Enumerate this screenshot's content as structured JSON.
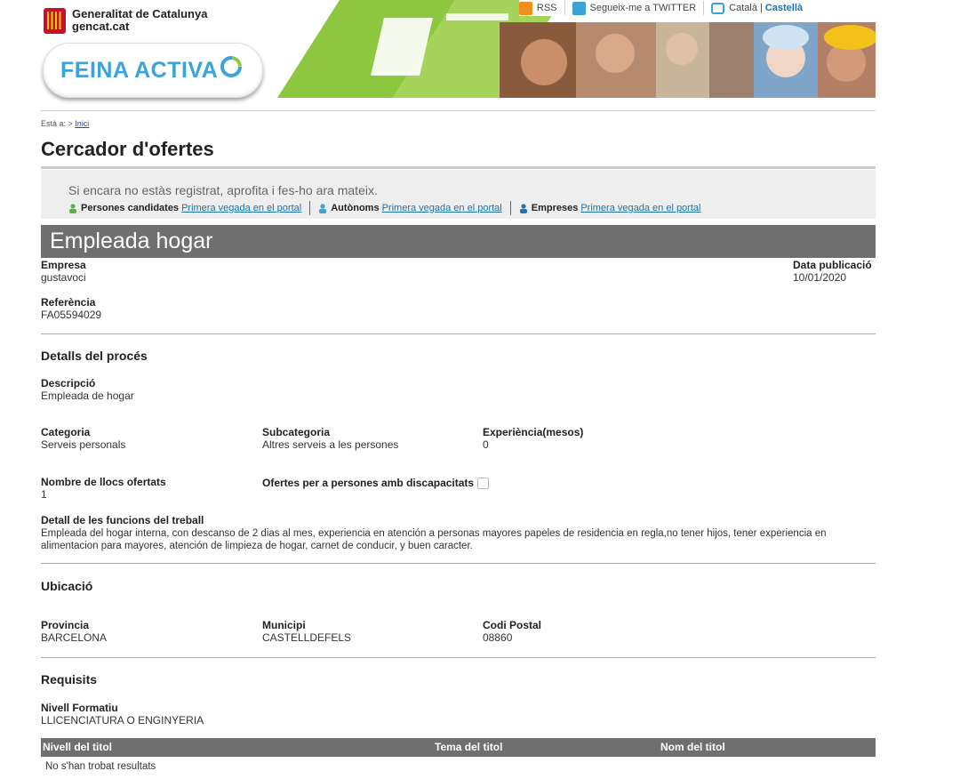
{
  "header": {
    "gencat_line1": "Generalitat de Catalunya",
    "gencat_line2": "gencat.cat",
    "logo_text": "FEINA ACTIVA",
    "toplinks": {
      "rss": "RSS",
      "twitter": "Segueix-me a TWITTER",
      "lang_ca": "Català",
      "lang_sep": "|",
      "lang_es": "Castellà"
    }
  },
  "breadcrumb": {
    "prefix": "Està a: >",
    "home": "Inici"
  },
  "page_title": "Cercador d'ofertes",
  "notice": {
    "main": "Si encara no estàs registrat, aprofita i fes-ho ara mateix.",
    "links": [
      {
        "label": "Persones candidates",
        "link": "Primera vegada en el portal"
      },
      {
        "label": "Autònoms",
        "link": "Primera vegada en el portal"
      },
      {
        "label": "Empreses",
        "link": "Primera vegada en el portal"
      }
    ]
  },
  "offer": {
    "title": "Empleada hogar",
    "empresa_label": "Empresa",
    "empresa": "gustavoci",
    "data_label": "Data publicació",
    "data": "10/01/2020",
    "ref_label": "Referència",
    "ref": "FA05594029"
  },
  "process": {
    "heading": "Detalls del procés",
    "descr_label": "Descripció",
    "descr": "Empleada de hogar",
    "cat_label": "Categoria",
    "cat": "Serveis personals",
    "subcat_label": "Subcategoria",
    "subcat": "Altres serveis a les persones",
    "exp_label": "Experiència(mesos)",
    "exp": "0",
    "llocs_label": "Nombre de llocs ofertats",
    "llocs": "1",
    "disc_label": "Ofertes per a persones amb discapacitats",
    "func_label": "Detall de les funcions del treball",
    "func": "Empleada del hogar interna, con descanso de 2 dias al mes, experiencia en atención a personas mayores papeles de residencia en regla,no tener hijos, tener experiencia en alimentacion para mayores, atención de limpieza de hogar, carnet de conducir, y buen caracter."
  },
  "location": {
    "heading": "Ubicació",
    "prov_label": "Provincia",
    "prov": "BARCELONA",
    "mun_label": "Municipi",
    "mun": "CASTELLDEFELS",
    "cp_label": "Codi Postal",
    "cp": "08860"
  },
  "requirements": {
    "heading": "Requisits",
    "nivell_label": "Nivell Formatiu",
    "nivell": "LLICENCIATURA O ENGINYERIA",
    "columns": [
      "Nivell del titol",
      "Tema del titol",
      "Nom del titol"
    ],
    "no_results": "No s'han trobat resultats"
  },
  "colors": {
    "accent_green": "#8dc63f",
    "gray_bar": "#6f6f6f",
    "link_blue": "#1a74b4",
    "logo_blue": "#3aa3d8"
  }
}
